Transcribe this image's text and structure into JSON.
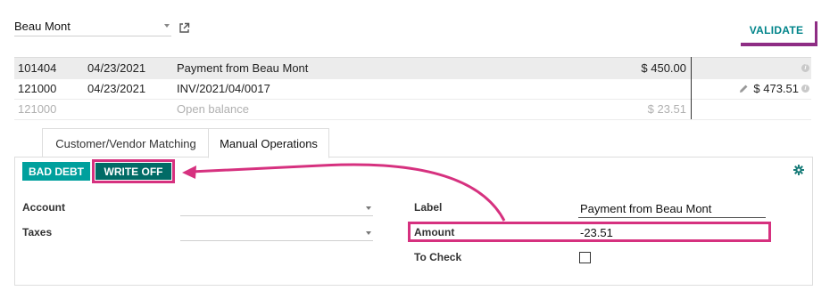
{
  "partner": {
    "name": "Beau Mont"
  },
  "toolbar": {
    "validate_label": "VALIDATE"
  },
  "lines": [
    {
      "account": "101404",
      "date": "04/23/2021",
      "label": "Payment from Beau Mont",
      "debit": "$ 450.00",
      "credit": ""
    },
    {
      "account": "121000",
      "date": "04/23/2021",
      "label": "INV/2021/04/0017",
      "debit": "",
      "credit": "$ 473.51"
    },
    {
      "account": "121000",
      "date": "",
      "label": "Open balance",
      "debit": "$ 23.51",
      "credit": ""
    }
  ],
  "tabs": [
    {
      "label": "Customer/Vendor Matching"
    },
    {
      "label": "Manual Operations"
    }
  ],
  "manual": {
    "bad_debt_label": "BAD DEBT",
    "write_off_label": "WRITE OFF",
    "account_label": "Account",
    "account_value": "",
    "taxes_label": "Taxes",
    "taxes_value": "",
    "label_label": "Label",
    "label_value": "Payment from Beau Mont",
    "amount_label": "Amount",
    "amount_value": "-23.51",
    "to_check_label": "To Check",
    "to_check": false
  },
  "colors": {
    "accent": "#00a09d",
    "accent_dark": "#016b66",
    "highlight": "#d6317f",
    "shadow": "#8e2d84"
  }
}
